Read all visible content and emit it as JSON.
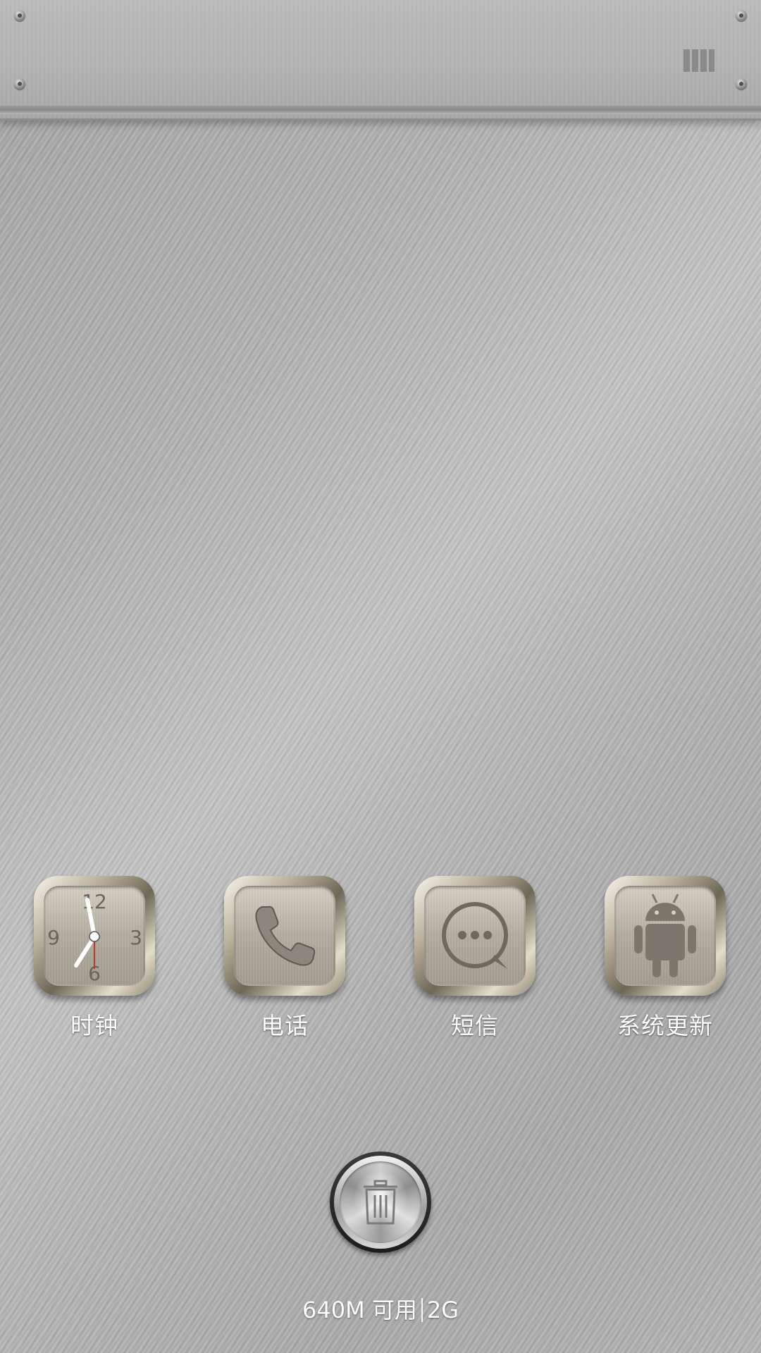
{
  "top_bar": {
    "menu_icon": "columns-menu-icon"
  },
  "dock": {
    "apps": [
      {
        "label": "时钟",
        "icon": "clock-icon"
      },
      {
        "label": "电话",
        "icon": "phone-icon"
      },
      {
        "label": "短信",
        "icon": "message-icon"
      },
      {
        "label": "系统更新",
        "icon": "android-icon"
      }
    ]
  },
  "clock_face": {
    "n12": "12",
    "n3": "3",
    "n6": "6",
    "n9": "9"
  },
  "clean_button": {
    "icon": "trash-icon"
  },
  "memory": {
    "available": "640M 可用",
    "total": "2G"
  },
  "colors": {
    "label_text": "#ffffff",
    "clock_second_hand": "#c0392b"
  }
}
